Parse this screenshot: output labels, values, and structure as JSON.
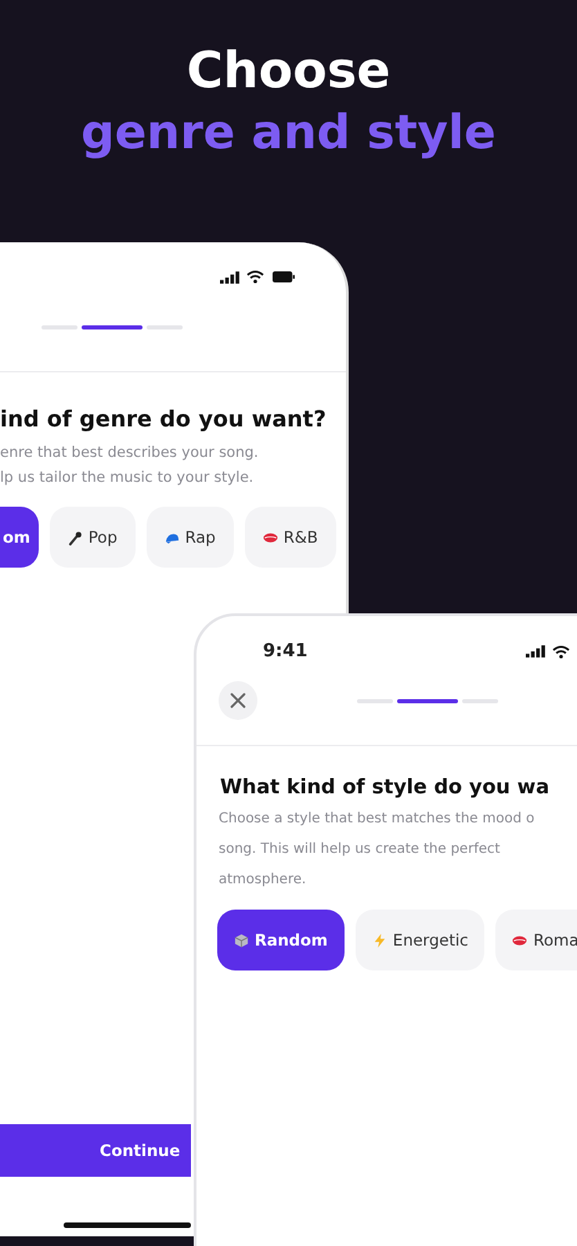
{
  "headline": {
    "line_1": "Choose",
    "line_2": "genre and style"
  },
  "phone_back": {
    "steps": [
      {
        "selected": false
      },
      {
        "selected": true
      },
      {
        "selected": false
      }
    ],
    "title": "ind of genre do you want?",
    "description_lines": [
      "enre that best describes your song.",
      "lp us tailor the music to your style."
    ],
    "chips": [
      {
        "label": "om",
        "kind": "none",
        "selected": true
      },
      {
        "label": "Pop",
        "kind": "microphone",
        "selected": false
      },
      {
        "label": "Rap",
        "kind": "cap",
        "selected": false
      },
      {
        "label": "R&B",
        "kind": "lips",
        "selected": false
      }
    ],
    "continue_button": "Continue"
  },
  "phone_front": {
    "time": "9:41",
    "steps": [
      {
        "selected": false
      },
      {
        "selected": true
      },
      {
        "selected": false
      }
    ],
    "title": "What kind of style do you wa",
    "description_lines": [
      "Choose a style that best matches the mood o",
      "song. This will help us create the perfect",
      "atmosphere."
    ],
    "chips": [
      {
        "label": "Random",
        "kind": "cube",
        "selected": true
      },
      {
        "label": "Energetic",
        "kind": "lightning",
        "selected": false
      },
      {
        "label": "Roma",
        "kind": "lips",
        "selected": false
      }
    ]
  }
}
